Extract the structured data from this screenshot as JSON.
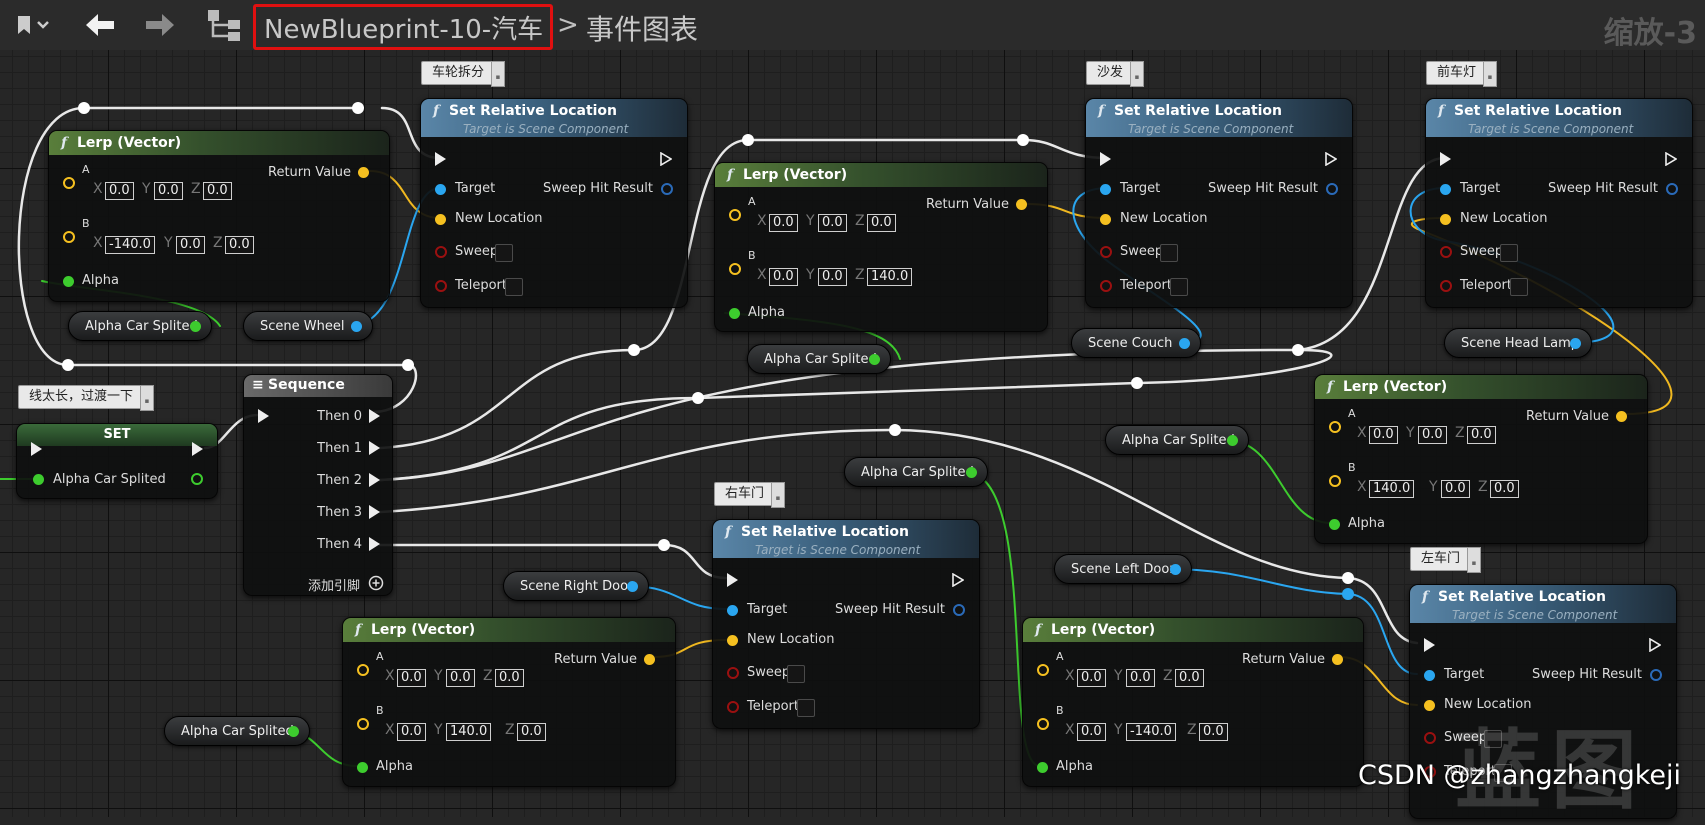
{
  "toolbar": {
    "blueprint_name": "NewBlueprint-10-汽车",
    "separator": ">",
    "graph_name": "事件图表",
    "zoom": "缩放-3"
  },
  "colors": {
    "highlight_box": "#e01010",
    "pin_vector": "#f5c020",
    "pin_float": "#3dcc2e",
    "pin_object": "#2aa6f0",
    "pin_bool": "#9a1010",
    "exec": "#eeeeee",
    "lerp_header": "#597e3b",
    "function_header": "#5a86a8"
  },
  "labels": {
    "lerp_title": "Lerp (Vector)",
    "srl_title": "Set Relative Location",
    "srl_sub": "Target is Scene Component",
    "return_value": "Return Value",
    "pin_a": "A",
    "pin_b": "B",
    "alpha": "Alpha",
    "target": "Target",
    "new_location": "New Location",
    "sweep": "Sweep",
    "teleport": "Teleport",
    "sweep_hit": "Sweep Hit Result",
    "ax_x": "X",
    "ax_y": "Y",
    "ax_z": "Z",
    "fn_icon": "f"
  },
  "lerp_nodes": [
    {
      "a": [
        "0.0",
        "0.0",
        "0.0"
      ],
      "b": [
        "-140.0",
        "0.0",
        "0.0"
      ]
    },
    {
      "a": [
        "0.0",
        "0.0",
        "0.0"
      ],
      "b": [
        "0.0",
        "0.0",
        "140.0"
      ]
    },
    {
      "a": [
        "0.0",
        "0.0",
        "0.0"
      ],
      "b": [
        "140.0",
        "0.0",
        "0.0"
      ]
    },
    {
      "a": [
        "0.0",
        "0.0",
        "0.0"
      ],
      "b": [
        "0.0",
        "140.0",
        "0.0"
      ]
    },
    {
      "a": [
        "0.0",
        "0.0",
        "0.0"
      ],
      "b": [
        "0.0",
        "-140.0",
        "0.0"
      ]
    }
  ],
  "comments": [
    "车轮拆分",
    "沙发",
    "前车灯",
    "线太长，过渡一下",
    "右车门",
    "左车门"
  ],
  "variables": [
    "Alpha Car Splited",
    "Scene Wheel",
    "Alpha Car Splited",
    "Scene Couch",
    "Scene Head Lamp",
    "Alpha Car Splited",
    "Alpha Car Splited",
    "Scene Right Door",
    "Scene Left Door",
    "Alpha Car Splited"
  ],
  "set_node": {
    "title": "SET",
    "pin": "Alpha Car Splited"
  },
  "sequence": {
    "icon": "≡",
    "title": "Sequence",
    "outputs": [
      "Then 0",
      "Then 1",
      "Then 2",
      "Then 3",
      "Then 4"
    ],
    "add_pin": "添加引脚"
  },
  "watermark": "CSDN @zhangzhangkeji",
  "watermark_char": "蓝图"
}
